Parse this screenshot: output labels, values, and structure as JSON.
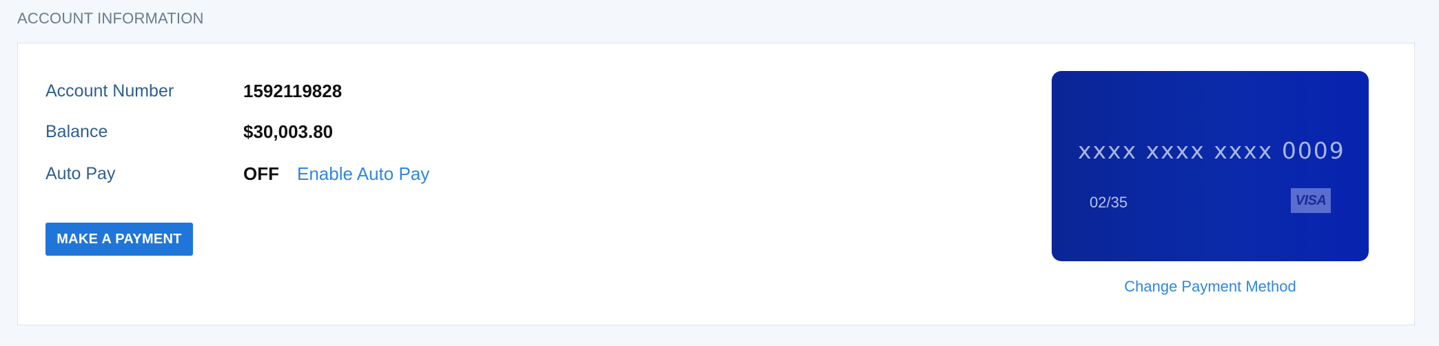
{
  "section": {
    "title": "ACCOUNT INFORMATION"
  },
  "account": {
    "number_label": "Account Number",
    "number_value": "1592119828",
    "balance_label": "Balance",
    "balance_value": "$30,003.80",
    "autopay_label": "Auto Pay",
    "autopay_value": "OFF",
    "autopay_link": "Enable Auto Pay"
  },
  "actions": {
    "make_payment": "MAKE A PAYMENT"
  },
  "card": {
    "masked_number": "xxxx xxxx xxxx 0009",
    "expiry": "02/35",
    "brand": "VISA",
    "change_link": "Change Payment Method"
  },
  "colors": {
    "accent": "#1f76d8",
    "link": "#2f86de",
    "label": "#2f5f8f",
    "card_background": "#0a2aaa"
  }
}
